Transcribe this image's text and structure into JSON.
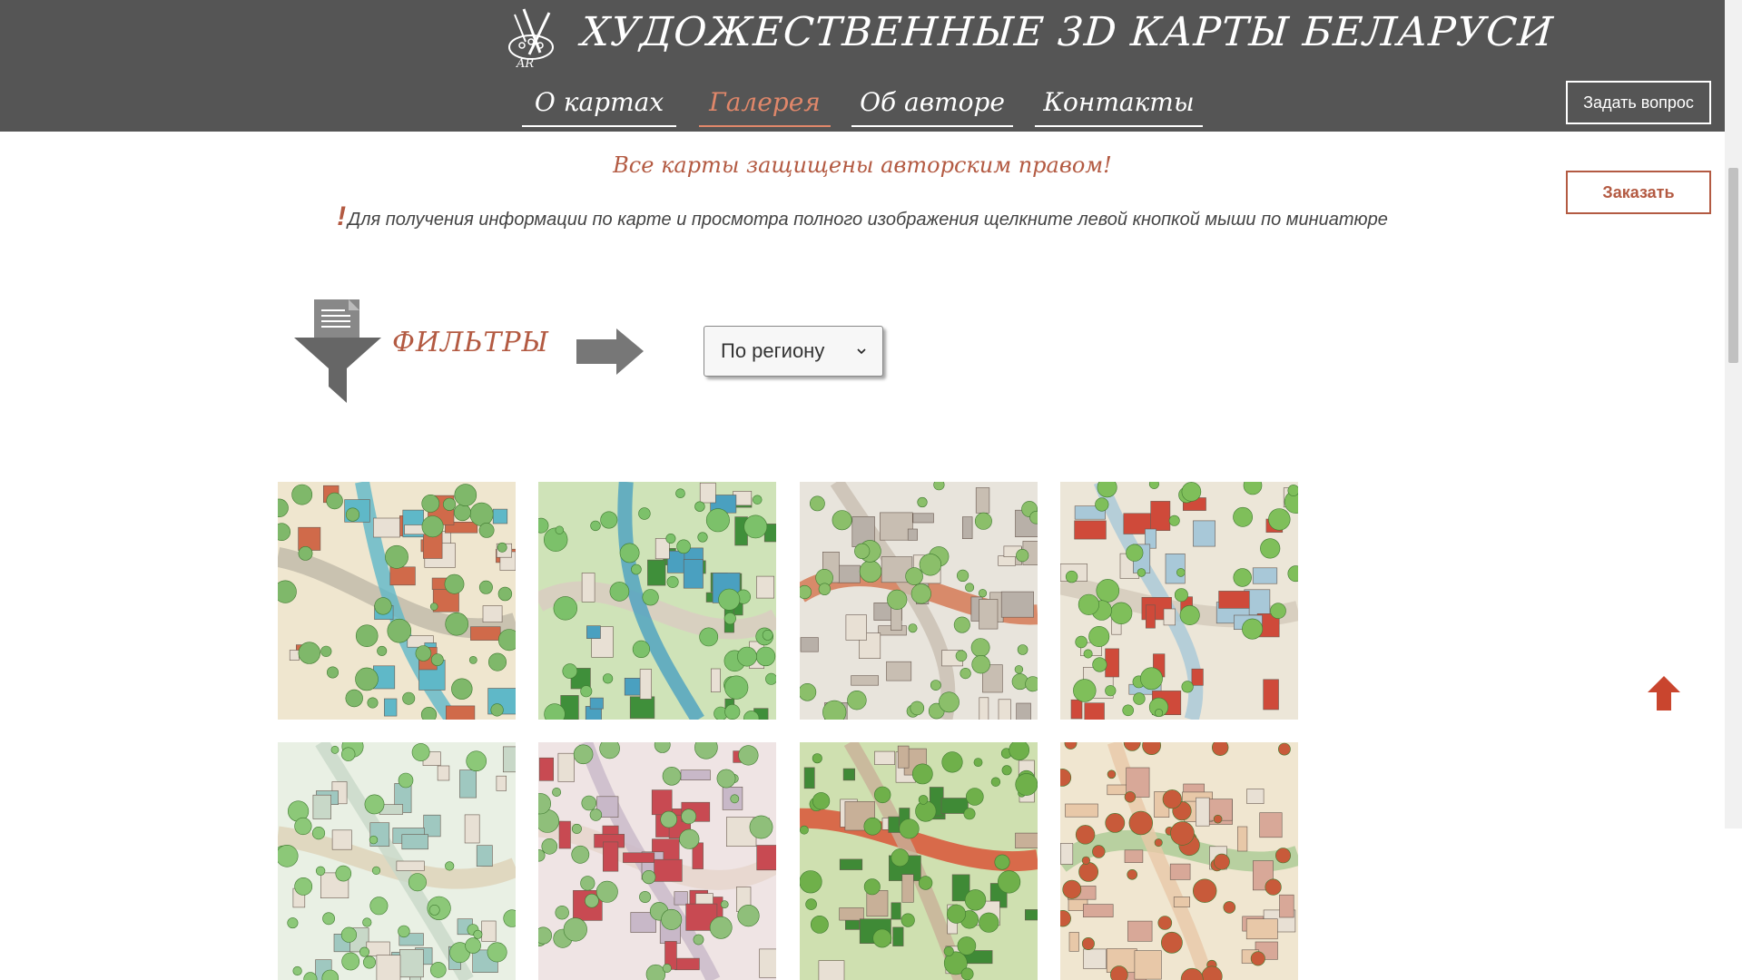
{
  "header": {
    "logo_text": "AR",
    "title": "ХУДОЖЕСТВЕННЫЕ 3D КАРТЫ БЕЛАРУСИ",
    "nav": [
      {
        "label": "О картах",
        "active": false
      },
      {
        "label": "Галерея",
        "active": true
      },
      {
        "label": "Об авторе",
        "active": false
      },
      {
        "label": "Контакты",
        "active": false
      }
    ],
    "ask_button": "Задать вопрос"
  },
  "order_button": "Заказать",
  "main": {
    "copyright_notice": "Все карты защищены авторским правом!",
    "hint_mark": "!",
    "hint": "Для получения информации по карте и просмотра полного изображения щелкните левой кнопкой мыши по миниатюре",
    "filter_label": "ФИЛЬТРЫ",
    "filter_select": {
      "selected": "По региону"
    }
  },
  "gallery": [
    {
      "name": "map-thumbnail-1"
    },
    {
      "name": "map-thumbnail-2"
    },
    {
      "name": "map-thumbnail-3"
    },
    {
      "name": "map-thumbnail-4"
    },
    {
      "name": "map-thumbnail-5"
    },
    {
      "name": "map-thumbnail-6"
    },
    {
      "name": "map-thumbnail-7"
    },
    {
      "name": "map-thumbnail-8"
    }
  ],
  "colors": {
    "header_bg": "#555555",
    "accent": "#b35a42",
    "nav_active": "#e0876a"
  }
}
